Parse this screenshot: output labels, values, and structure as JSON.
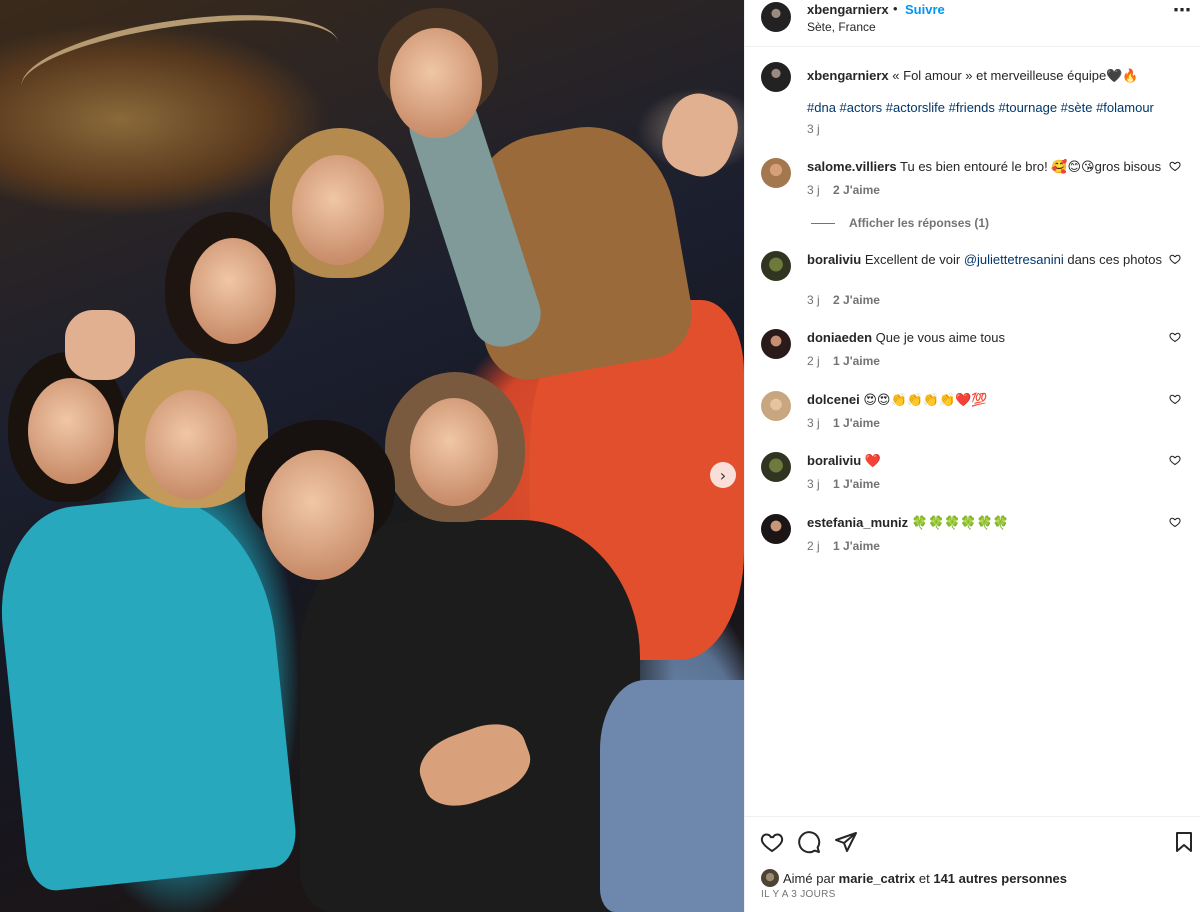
{
  "header": {
    "username": "xbengarnierx",
    "separator": "•",
    "follow_label": "Suivre",
    "location": "Sète, France",
    "more_icon": "more-horizontal-icon"
  },
  "caption": {
    "username": "xbengarnierx",
    "text": "« Fol amour » et merveilleuse équipe🖤🔥",
    "hashtags": "#dna #actors #actorslife #friends #tournage #sète #folamour",
    "time": "3 j"
  },
  "comments": [
    {
      "username": "salome.villiers",
      "text": "Tu es bien entouré le bro! 🥰😊😘gros bisous",
      "time": "3 j",
      "likes": "2 J'aime"
    },
    {
      "username": "boraliviu",
      "text_before": "Excellent de voir ",
      "mention": "@juliettetresanini",
      "text_after": " dans ces photos",
      "time": "3 j",
      "likes": "2 J'aime"
    },
    {
      "username": "doniaeden",
      "text": "Que je vous aime tous",
      "time": "2 j",
      "likes": "1 J'aime"
    },
    {
      "username": "dolcenei",
      "text": "😍😍👏👏👏👏❤️💯",
      "time": "3 j",
      "likes": "1 J'aime"
    },
    {
      "username": "boraliviu",
      "text": "❤️",
      "time": "3 j",
      "likes": "1 J'aime"
    },
    {
      "username": "estefania_muniz",
      "text": "🍀🍀🍀🍀🍀🍀",
      "time": "2 j",
      "likes": "1 J'aime"
    }
  ],
  "replies_label": "Afficher les réponses (1)",
  "liked_by": {
    "prefix": "Aimé par ",
    "user": "marie_catrix",
    "middle": " et ",
    "others": "141 autres personnes"
  },
  "post_date": "IL Y A 3 JOURS",
  "icons": {
    "like": "heart-icon",
    "comment": "comment-icon",
    "share": "share-icon",
    "save": "bookmark-icon",
    "carousel_next": "chevron-right-icon"
  },
  "colors": {
    "follow": "#0095f6",
    "hashtag": "#00376b",
    "meta": "#737373"
  }
}
